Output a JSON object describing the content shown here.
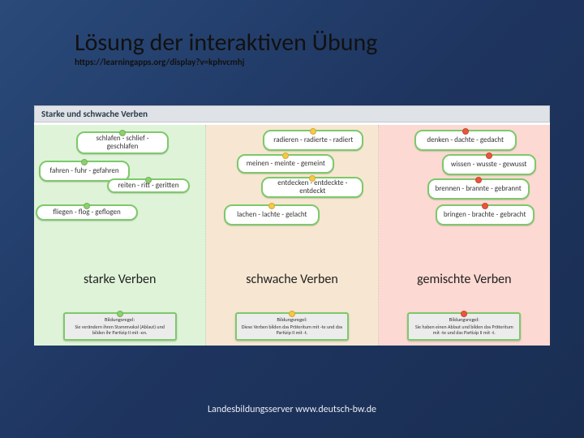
{
  "slide": {
    "title": "Lösung der interaktiven Übung",
    "url": "https://learningapps.org/display?v=kphvcmhj",
    "footer": "Landesbildungsserver www.deutsch-bw.de"
  },
  "app": {
    "title": "Starke und schwache Verben",
    "columns": [
      {
        "label": "starke Verben",
        "cards": [
          "schlafen - schlief - geschlafen",
          "fahren - fuhr - gefahren",
          "reiten - ritt - geritten",
          "fliegen - flog - geflogen"
        ],
        "rule_title": "Bildungsregel:",
        "rule_body": "Sie verändern ihren Stammvokal (Ablaut) und bilden ihr Partizip II mit -en."
      },
      {
        "label": "schwache Verben",
        "cards": [
          "radieren - radierte - radiert",
          "meinen - meinte - gemeint",
          "entdecken - entdeckte - entdeckt",
          "lachen - lachte - gelacht"
        ],
        "rule_title": "Bildungsregel:",
        "rule_body": "Diese Verben bilden das Präteritum mit -te und das Partizip II mit -t."
      },
      {
        "label": "gemischte Verben",
        "cards": [
          "denken - dachte - gedacht",
          "wissen - wusste - gewusst",
          "brennen - brannte - gebrannt",
          "bringen - brachte - gebracht"
        ],
        "rule_title": "Bildungsregel:",
        "rule_body": "Sie haben einen Ablaut und bilden das Präteritum mit -te und das Partizip II mit -t."
      }
    ]
  }
}
